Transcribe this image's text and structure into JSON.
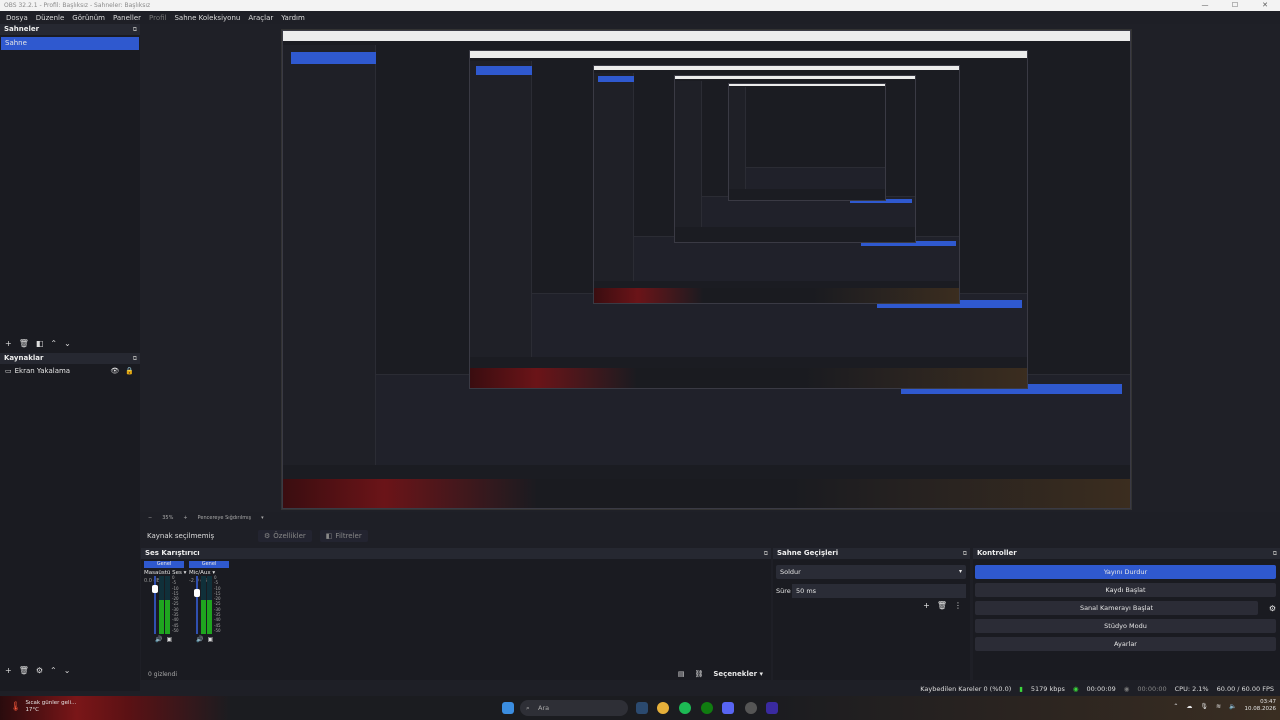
{
  "window": {
    "title": "OBS 32.2.1 - Profil: Başlıksız - Sahneler: Başlıksız",
    "min": "—",
    "max": "☐",
    "close": "✕"
  },
  "menu": [
    "Dosya",
    "Düzenle",
    "Görünüm",
    "Paneller",
    "Profil",
    "Sahne Koleksiyonu",
    "Araçlar",
    "Yardım"
  ],
  "scenes": {
    "title": "Sahneler",
    "items": [
      "Sahne"
    ]
  },
  "sources": {
    "title": "Kaynaklar",
    "items": [
      "Ekran Yakalama"
    ]
  },
  "zoom": {
    "value": "35%",
    "mode": "Pencereye Sığdırılmış"
  },
  "context": {
    "no_source": "Kaynak seçilmemiş",
    "properties": "Özellikler",
    "filters": "Filtreler"
  },
  "mixer": {
    "title": "Ses Karıştırıcı",
    "channels": [
      {
        "header": "Genel",
        "name": "Masaüstü Ses",
        "db": "0.0 dB"
      },
      {
        "header": "Genel",
        "name": "Mic/Aux",
        "db": "-2.9 dB"
      }
    ],
    "scale": [
      "0",
      "-5",
      "-10",
      "-15",
      "-20",
      "-25",
      "-30",
      "-35",
      "-40",
      "-45",
      "-50",
      "-55",
      "-60"
    ],
    "hidden": "0 gizlendi",
    "options": "Seçenekler"
  },
  "transitions": {
    "title": "Sahne Geçişleri",
    "selected": "Soldur",
    "duration_label": "Süre",
    "duration_value": "50 ms"
  },
  "controls": {
    "title": "Kontroller",
    "stop_stream": "Yayını Durdur",
    "start_record": "Kaydı Başlat",
    "virtual_cam": "Sanal Kamerayı Başlat",
    "studio_mode": "Stüdyo Modu",
    "settings": "Ayarlar"
  },
  "status": {
    "dropped": "Kaybedilen Kareler 0 (%0.0)",
    "bitrate": "5179 kbps",
    "stream_time": "00:00:09",
    "record_time": "00:00:00",
    "cpu": "CPU: 2.1%",
    "fps": "60.00 / 60.00 FPS"
  },
  "taskbar": {
    "weather_line1": "Sıcak günler geli...",
    "weather_line2": "17°C",
    "search": "Ara",
    "time": "03:47",
    "date": "10.08.2026"
  },
  "colors": {
    "accent": "#2f59cf",
    "meter_green": "#1fa51f",
    "bg": "#1e1f26"
  }
}
